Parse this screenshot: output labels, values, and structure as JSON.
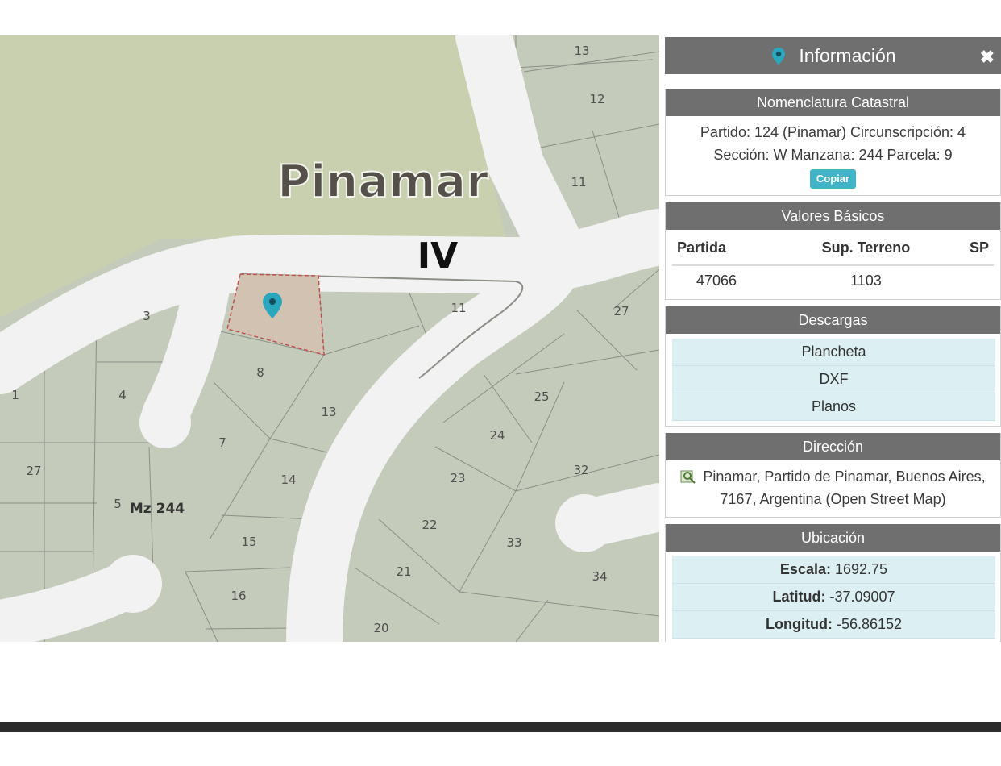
{
  "map": {
    "city_label": "Pinamar",
    "sector_label": "IV",
    "manzana_label": "Mz 244",
    "lot_labels": [
      "13",
      "12",
      "11",
      "3",
      "11",
      "27",
      "1",
      "4",
      "8",
      "13",
      "25",
      "7",
      "24",
      "27",
      "5",
      "14",
      "23",
      "32",
      "22",
      "15",
      "33",
      "21",
      "34",
      "16",
      "20"
    ]
  },
  "panel": {
    "title": "Información",
    "close_icon": "close-icon",
    "nomenclatura": {
      "header": "Nomenclatura Catastral",
      "line1": "Partido: 124 (Pinamar) Circunscripción: 4",
      "line2": "Sección: W Manzana: 244 Parcela: 9",
      "copy_button": "Copiar"
    },
    "valores": {
      "header": "Valores Básicos",
      "columns": [
        "Partida",
        "Sup. Terreno",
        "SP"
      ],
      "row": [
        "47066",
        "1103",
        ""
      ]
    },
    "descargas": {
      "header": "Descargas",
      "items": [
        "Plancheta",
        "DXF",
        "Planos"
      ]
    },
    "direccion": {
      "header": "Dirección",
      "text": "Pinamar, Partido de Pinamar, Buenos Aires, 7167, Argentina (Open Street Map)"
    },
    "ubicacion": {
      "header": "Ubicación",
      "escala_label": "Escala:",
      "escala_value": "1692.75",
      "latitud_label": "Latitud:",
      "latitud_value": "-37.09007",
      "longitud_label": "Longitud:",
      "longitud_value": "-56.86152"
    }
  },
  "colors": {
    "park": "#c8d0b0",
    "lots": "#c4cbbb",
    "road": "#f2f2f2",
    "selected_lot": "#d2c2b2",
    "accent": "#43b4c8",
    "header": "#6f6f6f"
  }
}
